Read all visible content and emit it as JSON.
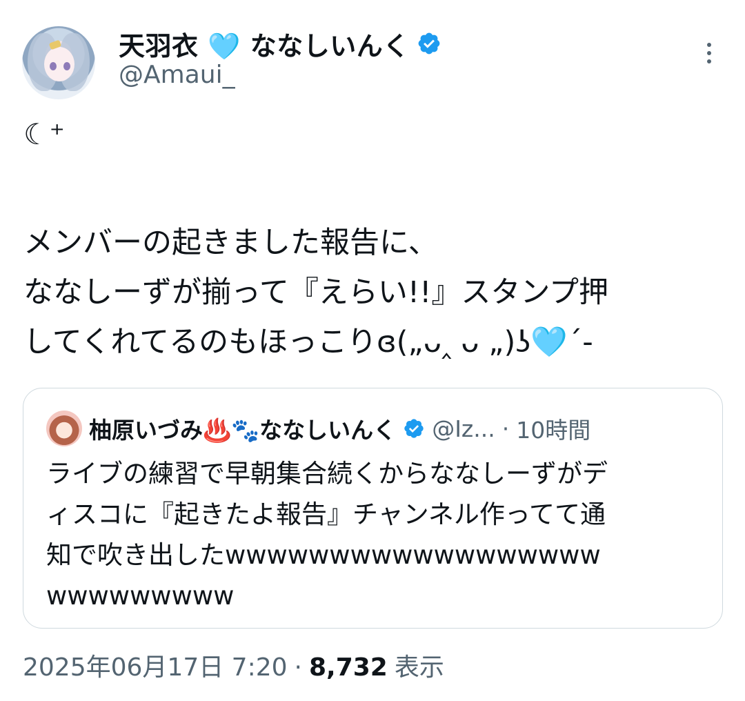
{
  "author": {
    "display_name": "天羽衣 🩵 ななしいんく",
    "handle": "@Amaui_",
    "verified": true,
    "avatar": "avatar-anime-girl-silver-hair"
  },
  "more_icon": "more-vertical-icon",
  "tweet": {
    "moon_symbol": "☾⁺",
    "lines": [
      "メンバーの起きました報告に、",
      "ななしーずが揃って『えらい!!』スタンプ押",
      "してくれてるのもほっこりɞ(„ᴗ‸ ᴗ „)ʖ🩵´-"
    ]
  },
  "quote": {
    "display_name": "柚原いづみ♨️🐾ななしいんく",
    "handle": "@Iz...",
    "separator": "·",
    "time": "10時間",
    "verified": true,
    "lines": [
      "ライブの練習で早朝集合続くからななしーずがデ",
      "ィスコに『起きたよ報告』チャンネル作ってて通",
      "知で吹き出したwwwwwwwwwwwwwwwwww",
      "wwwwwwwww"
    ]
  },
  "meta": {
    "datetime": "2025年06月17日 7:20",
    "separator": "·",
    "views_count": "8,732",
    "views_label": "表示"
  },
  "colors": {
    "verified_blue": "#1d9bf0",
    "text_primary": "#0f1419",
    "text_secondary": "#536471",
    "border": "#cfd9de"
  }
}
